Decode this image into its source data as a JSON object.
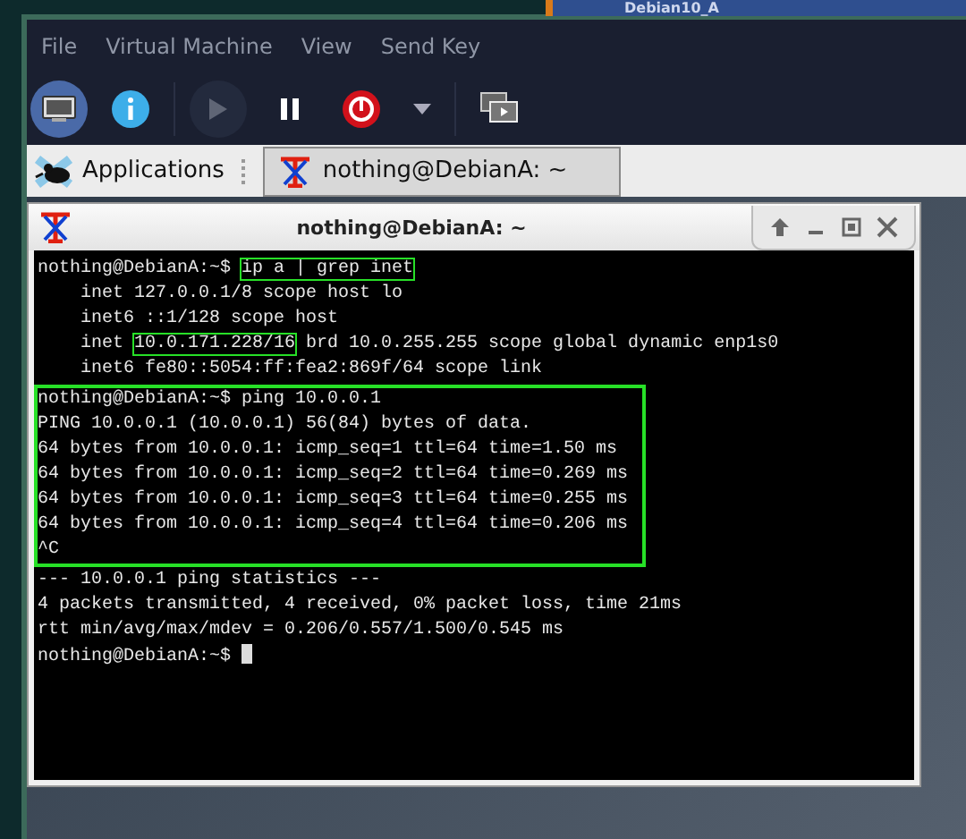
{
  "taskbar": {
    "item": "Debian10_A"
  },
  "menu": [
    "File",
    "Virtual Machine",
    "View",
    "Send Key"
  ],
  "toolbar": [
    {
      "kind": "console",
      "selected": true,
      "disabled": false
    },
    {
      "kind": "info",
      "selected": false,
      "disabled": false
    },
    {
      "kind": "play",
      "selected": false,
      "disabled": true
    },
    {
      "kind": "pause",
      "selected": false,
      "disabled": false
    },
    {
      "kind": "power",
      "selected": false,
      "disabled": false
    },
    {
      "kind": "caret",
      "selected": false,
      "disabled": false
    },
    {
      "kind": "screens",
      "selected": false,
      "disabled": false
    }
  ],
  "panel": {
    "applications": "Applications",
    "tasks": [
      {
        "title": "nothing@DebianA: ~",
        "selected": true
      }
    ]
  },
  "terminal": {
    "title": "nothing@DebianA: ~",
    "blocks": [
      {
        "boxed": false,
        "lines": [
          [
            {
              "text": "nothing@DebianA:~$ ",
              "boxed": false
            },
            {
              "text": "ip a | grep inet",
              "boxed": true
            }
          ],
          [
            {
              "text": "    inet 127.0.0.1/8 scope host lo",
              "boxed": false
            }
          ],
          [
            {
              "text": "    inet6 ::1/128 scope host",
              "boxed": false
            }
          ],
          [
            {
              "text": "    inet ",
              "boxed": false
            },
            {
              "text": "10.0.171.228/16",
              "boxed": true
            },
            {
              "text": " brd 10.0.255.255 scope global dynamic enp1s0",
              "boxed": false
            }
          ],
          [
            {
              "text": "    inet6 fe80::5054:ff:fea2:869f/64 scope link",
              "boxed": false
            }
          ]
        ]
      },
      {
        "boxed": true,
        "lines": [
          [
            {
              "text": "nothing@DebianA:~$ ping 10.0.0.1",
              "boxed": false
            }
          ],
          [
            {
              "text": "PING 10.0.0.1 (10.0.0.1) 56(84) bytes of data.",
              "boxed": false
            }
          ],
          [
            {
              "text": "64 bytes from 10.0.0.1: icmp_seq=1 ttl=64 time=1.50 ms",
              "boxed": false
            }
          ],
          [
            {
              "text": "64 bytes from 10.0.0.1: icmp_seq=2 ttl=64 time=0.269 ms",
              "boxed": false
            }
          ],
          [
            {
              "text": "64 bytes from 10.0.0.1: icmp_seq=3 ttl=64 time=0.255 ms",
              "boxed": false
            }
          ],
          [
            {
              "text": "64 bytes from 10.0.0.1: icmp_seq=4 ttl=64 time=0.206 ms",
              "boxed": false
            }
          ],
          [
            {
              "text": "^C",
              "boxed": false
            }
          ]
        ]
      },
      {
        "boxed": false,
        "lines": [
          [
            {
              "text": "--- 10.0.0.1 ping statistics ---",
              "boxed": false
            }
          ],
          [
            {
              "text": "4 packets transmitted, 4 received, 0% packet loss, time 21ms",
              "boxed": false
            }
          ],
          [
            {
              "text": "rtt min/avg/max/mdev = 0.206/0.557/1.500/0.545 ms",
              "boxed": false
            }
          ],
          [
            {
              "text": "nothing@DebianA:~$ ",
              "boxed": false
            }
          ]
        ]
      }
    ]
  }
}
